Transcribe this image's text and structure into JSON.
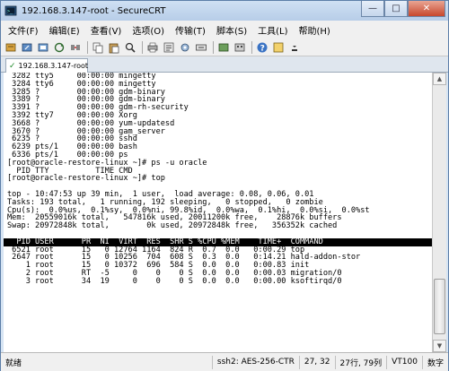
{
  "window": {
    "title": "192.168.3.147-root - SecureCRT"
  },
  "menu": [
    "文件(F)",
    "编辑(E)",
    "查看(V)",
    "选项(O)",
    "传输(T)",
    "脚本(S)",
    "工具(L)",
    "帮助(H)"
  ],
  "tab": {
    "label": "192.168.3.147-root"
  },
  "terminal_lines": [
    {
      "text": " 3282 tty5     00:00:00 mingetty",
      "inverse": false
    },
    {
      "text": " 3284 tty6     00:00:00 mingetty",
      "inverse": false
    },
    {
      "text": " 3285 ?        00:00:00 gdm-binary",
      "inverse": false
    },
    {
      "text": " 3389 ?        00:00:00 gdm-binary",
      "inverse": false
    },
    {
      "text": " 3391 ?        00:00:00 gdm-rh-security",
      "inverse": false
    },
    {
      "text": " 3392 tty7     00:00:00 Xorg",
      "inverse": false
    },
    {
      "text": " 3668 ?        00:00:00 yum-updatesd",
      "inverse": false
    },
    {
      "text": " 3670 ?        00:00:00 gam_server",
      "inverse": false
    },
    {
      "text": " 6235 ?        00:00:00 sshd",
      "inverse": false
    },
    {
      "text": " 6239 pts/1    00:00:00 bash",
      "inverse": false
    },
    {
      "text": " 6336 pts/1    00:00:00 ps",
      "inverse": false
    },
    {
      "text": "[root@oracle-restore-linux ~]# ps -u oracle",
      "inverse": false
    },
    {
      "text": "  PID TTY          TIME CMD",
      "inverse": false
    },
    {
      "text": "[root@oracle-restore-linux ~]# top",
      "inverse": false
    },
    {
      "text": "",
      "inverse": false
    },
    {
      "text": "top - 10:47:53 up 39 min,  1 user,  load average: 0.08, 0.06, 0.01",
      "inverse": false
    },
    {
      "text": "Tasks: 193 total,   1 running, 192 sleeping,   0 stopped,   0 zombie",
      "inverse": false
    },
    {
      "text": "Cpu(s):  0.0%us,  0.1%sy,  0.0%ni, 99.8%id,  0.0%wa,  0.1%hi,  0.0%si,  0.0%st",
      "inverse": false
    },
    {
      "text": "Mem:  20559016k total,   547816k used, 20011200k free,    28876k buffers",
      "inverse": false
    },
    {
      "text": "Swap: 20972848k total,        0k used, 20972848k free,   356352k cached",
      "inverse": false
    },
    {
      "text": "",
      "inverse": false
    },
    {
      "text": "  PID USER      PR  NI  VIRT  RES  SHR S %CPU %MEM    TIME+  COMMAND",
      "inverse": true
    },
    {
      "text": " 6521 root      15   0 12764 1164  824 R  0.7  0.0   0:00.29 top",
      "inverse": false
    },
    {
      "text": " 2647 root      15   0 10256  704  608 S  0.3  0.0   0:14.21 hald-addon-stor",
      "inverse": false
    },
    {
      "text": "    1 root      15   0 10372  696  584 S  0.0  0.0   0:00.83 init",
      "inverse": false
    },
    {
      "text": "    2 root      RT  -5     0    0    0 S  0.0  0.0   0:00.03 migration/0",
      "inverse": false
    },
    {
      "text": "    3 root      34  19     0    0    0 S  0.0  0.0   0:00.00 ksoftirqd/0",
      "inverse": false
    }
  ],
  "status": {
    "ready": "就绪",
    "cipher": "ssh2: AES-256-CTR",
    "cursor": "27, 32",
    "size": "27行, 79列",
    "terminal_type": "VT100",
    "caps": "数字"
  },
  "colors": {
    "terminal_bg": "#ffffff",
    "header_bg": "#000000",
    "titlebar": "#b7cde8"
  }
}
